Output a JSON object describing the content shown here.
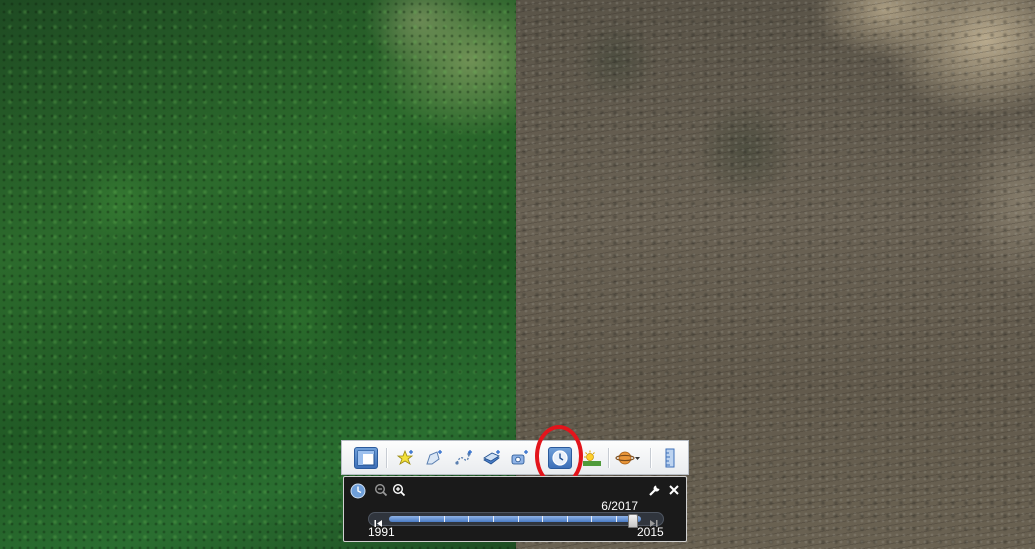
{
  "imagery": {
    "left_label": "",
    "right_label": ""
  },
  "toolbar": {
    "buttons": [
      {
        "name": "sidebar-toggle",
        "icon": "sidebar-icon"
      },
      {
        "name": "add-placemark",
        "icon": "placemark-icon"
      },
      {
        "name": "add-polygon",
        "icon": "polygon-icon"
      },
      {
        "name": "add-path",
        "icon": "path-icon"
      },
      {
        "name": "add-image-overlay",
        "icon": "image-overlay-icon"
      },
      {
        "name": "record-tour",
        "icon": "record-tour-icon"
      },
      {
        "name": "historical-imagery",
        "icon": "clock-icon",
        "active": true
      },
      {
        "name": "sunlight",
        "icon": "sun-icon"
      },
      {
        "name": "switch-planet",
        "icon": "planet-icon"
      },
      {
        "name": "ruler",
        "icon": "ruler-icon"
      }
    ]
  },
  "time_slider": {
    "current_date": "6/2017",
    "start_year": "1991",
    "end_year": "2015",
    "position_fraction": 0.97,
    "tick_count": 9
  },
  "colors": {
    "active_button": "#3d6fb8",
    "highlight_ring": "#e3141b",
    "panel_background": "#1a1a1a",
    "rail": "#4a7cc6"
  }
}
